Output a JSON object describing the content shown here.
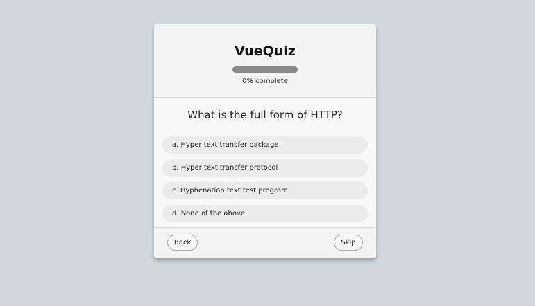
{
  "quiz": {
    "title": "VueQuiz",
    "progress": {
      "percent": 0,
      "label": "0% complete"
    }
  },
  "question": {
    "text": "What is the full form of HTTP?",
    "options": [
      "a. Hyper text transfer package",
      "b. Hyper text transfer protocol",
      "c. Hyphenation text test program",
      "d. None of the above"
    ]
  },
  "footer": {
    "back_label": "Back",
    "skip_label": "Skip"
  },
  "colors": {
    "background": "#d0d8de",
    "card": "#f4f4f4",
    "option": "#ececec",
    "progress_track": "#8a8a8a"
  }
}
